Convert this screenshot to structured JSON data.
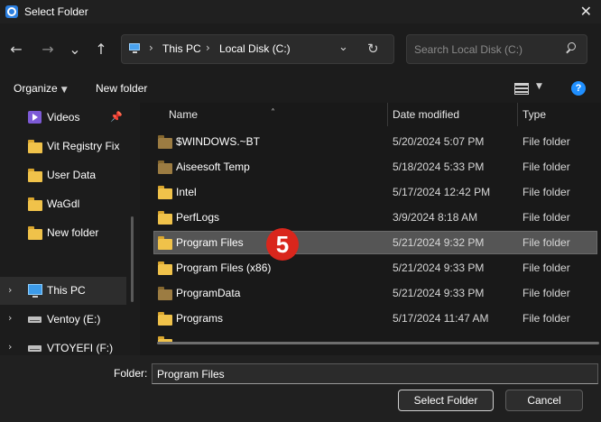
{
  "window": {
    "title": "Select Folder"
  },
  "nav": {
    "back": "←",
    "forward": "→",
    "recent": "⌄",
    "up": "↑"
  },
  "address": {
    "segments": [
      "This PC",
      "Local Disk (C:)"
    ],
    "separator": "›"
  },
  "search": {
    "placeholder": "Search Local Disk (C:)"
  },
  "toolbar": {
    "organize": "Organize",
    "new_folder": "New folder",
    "help": "?"
  },
  "sidebar": {
    "items": [
      {
        "label": "Videos"
      },
      {
        "label": "Vit Registry Fix"
      },
      {
        "label": "User Data"
      },
      {
        "label": "WaGdl"
      },
      {
        "label": "New folder"
      },
      {
        "label": "This PC"
      },
      {
        "label": "Ventoy (E:)"
      },
      {
        "label": "VTOYEFI (F:)"
      }
    ]
  },
  "columns": {
    "name": "Name",
    "date": "Date modified",
    "type": "Type"
  },
  "files": [
    {
      "name": "$WINDOWS.~BT",
      "date": "5/20/2024 5:07 PM",
      "type": "File folder",
      "hidden": true
    },
    {
      "name": "Aiseesoft Temp",
      "date": "5/18/2024 5:33 PM",
      "type": "File folder",
      "hidden": true
    },
    {
      "name": "Intel",
      "date": "5/17/2024 12:42 PM",
      "type": "File folder",
      "hidden": false
    },
    {
      "name": "PerfLogs",
      "date": "3/9/2024 8:18 AM",
      "type": "File folder",
      "hidden": false
    },
    {
      "name": "Program Files",
      "date": "5/21/2024 9:32 PM",
      "type": "File folder",
      "hidden": false,
      "selected": true
    },
    {
      "name": "Program Files (x86)",
      "date": "5/21/2024 9:33 PM",
      "type": "File folder",
      "hidden": false
    },
    {
      "name": "ProgramData",
      "date": "5/21/2024 9:33 PM",
      "type": "File folder",
      "hidden": true
    },
    {
      "name": "Programs",
      "date": "5/17/2024 11:47 AM",
      "type": "File folder",
      "hidden": false
    }
  ],
  "step_badge": "5",
  "bottom": {
    "folder_label": "Folder:",
    "folder_value": "Program Files",
    "select": "Select Folder",
    "cancel": "Cancel"
  },
  "colors": {
    "accent": "#1f8fff",
    "badge": "#d9261c",
    "selection": "#555555"
  }
}
